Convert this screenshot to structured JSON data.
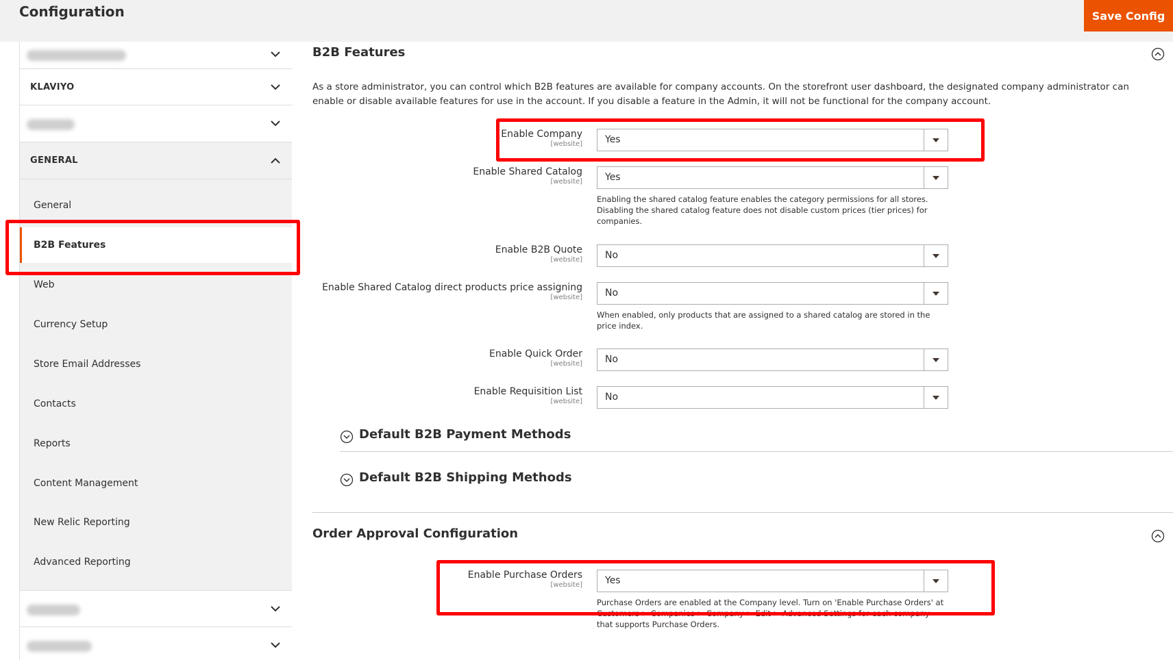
{
  "header": {
    "title": "Configuration",
    "save_label": "Save Config"
  },
  "sidebar": {
    "klaviyo_label": "KLAVIYO",
    "general_label": "GENERAL",
    "items": [
      {
        "label": "General"
      },
      {
        "label": "B2B Features"
      },
      {
        "label": "Web"
      },
      {
        "label": "Currency Setup"
      },
      {
        "label": "Store Email Addresses"
      },
      {
        "label": "Contacts"
      },
      {
        "label": "Reports"
      },
      {
        "label": "Content Management"
      },
      {
        "label": "New Relic Reporting"
      },
      {
        "label": "Advanced Reporting"
      }
    ]
  },
  "main": {
    "b2b_title": "B2B Features",
    "intro": "As a store administrator, you can control which B2B features are available for company accounts. On the storefront user dashboard, the designated company administrator can enable or disable available features for use in the account. If you disable a feature in the Admin, it will not be functional for the company account.",
    "fields": [
      {
        "label": "Enable Company",
        "scope": "[website]",
        "value": "Yes",
        "note": ""
      },
      {
        "label": "Enable Shared Catalog",
        "scope": "[website]",
        "value": "Yes",
        "note": "Enabling the shared catalog feature enables the category permissions for all stores. Disabling the shared catalog feature does not disable custom prices (tier prices) for companies."
      },
      {
        "label": "Enable B2B Quote",
        "scope": "[website]",
        "value": "No",
        "note": ""
      },
      {
        "label": "Enable Shared Catalog direct products price assigning",
        "scope": "[website]",
        "value": "No",
        "note": "When enabled, only products that are assigned to a shared catalog are stored in the price index."
      },
      {
        "label": "Enable Quick Order",
        "scope": "[website]",
        "value": "No",
        "note": ""
      },
      {
        "label": "Enable Requisition List",
        "scope": "[website]",
        "value": "No",
        "note": ""
      }
    ],
    "payment_title": "Default B2B Payment Methods",
    "shipping_title": "Default B2B Shipping Methods",
    "order_title": "Order Approval Configuration",
    "po_field": {
      "label": "Enable Purchase Orders",
      "scope": "[website]",
      "value": "Yes",
      "note": "Purchase Orders are enabled at the Company level. Turn on 'Enable Purchase Orders' at Customers > Companies > Company > Edit > Advanced Settings for each company that supports Purchase Orders."
    }
  },
  "colors": {
    "accent": "#eb5202",
    "highlight": "#ff0000"
  }
}
